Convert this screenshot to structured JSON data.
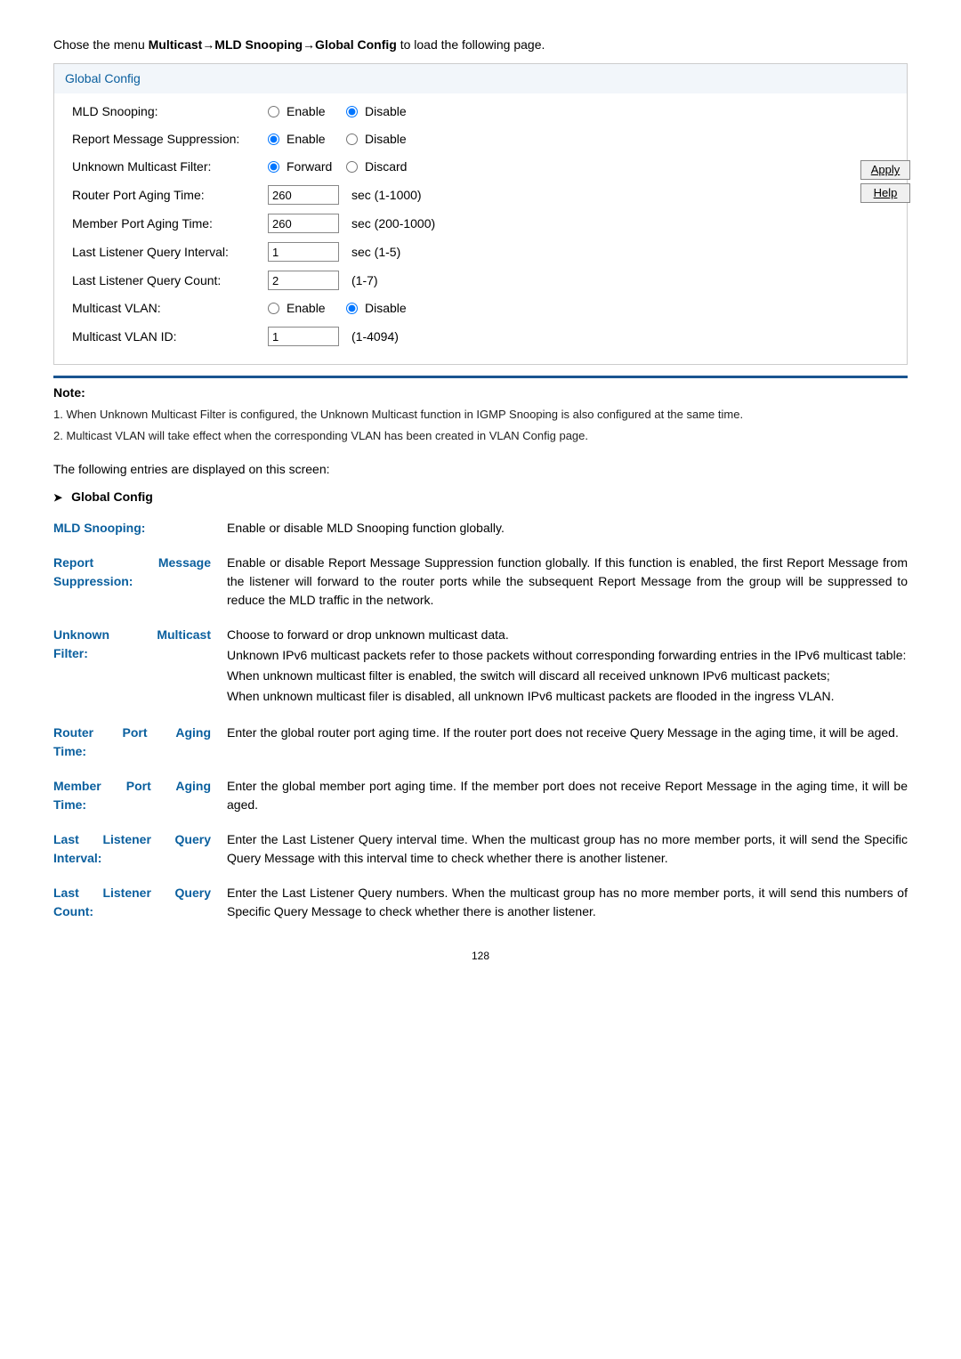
{
  "intro_prefix": "Chose the menu ",
  "intro_path": "Multicast→MLD Snooping→Global Config",
  "intro_suffix": " to load the following page.",
  "panel": {
    "title": "Global Config",
    "rows": {
      "mld_snooping": {
        "label": "MLD Snooping:",
        "opt1": "Enable",
        "opt2": "Disable"
      },
      "report_suppression": {
        "label": "Report Message Suppression:",
        "opt1": "Enable",
        "opt2": "Disable"
      },
      "unknown_filter": {
        "label": "Unknown Multicast Filter:",
        "opt1": "Forward",
        "opt2": "Discard"
      },
      "router_aging": {
        "label": "Router Port Aging Time:",
        "value": "260",
        "unit": "sec (1-1000)"
      },
      "member_aging": {
        "label": "Member Port Aging Time:",
        "value": "260",
        "unit": "sec (200-1000)"
      },
      "last_interval": {
        "label": "Last Listener Query Interval:",
        "value": "1",
        "unit": "sec (1-5)"
      },
      "last_count": {
        "label": "Last Listener Query Count:",
        "value": "2",
        "unit": "(1-7)"
      },
      "multicast_vlan": {
        "label": "Multicast VLAN:",
        "opt1": "Enable",
        "opt2": "Disable"
      },
      "multicast_vlan_id": {
        "label": "Multicast VLAN ID:",
        "value": "1",
        "unit": "(1-4094)"
      }
    },
    "apply": "Apply",
    "help": "Help"
  },
  "note": {
    "title": "Note:",
    "line1": "1. When Unknown Multicast Filter is configured, the Unknown Multicast function in IGMP Snooping is also configured at the same time.",
    "line2": "2. Multicast VLAN will take effect when the corresponding VLAN has been created in VLAN Config page."
  },
  "follow": "The following entries are displayed on this screen:",
  "section_title": "Global Config",
  "descriptions": {
    "mld": {
      "label": "MLD Snooping:",
      "text": "Enable or disable MLD Snooping function globally."
    },
    "report": {
      "label": "Report Message Suppression:",
      "text": "Enable or disable Report Message Suppression function globally. If this function is enabled, the first Report Message from the listener will forward to the router ports while the subsequent Report Message from the group will be suppressed to reduce the MLD traffic in the network."
    },
    "unknown": {
      "label": "Unknown Multicast Filter:",
      "p1": "Choose to forward or drop unknown multicast data.",
      "p2": "Unknown IPv6 multicast packets refer to those packets without corresponding forwarding entries in the IPv6 multicast table:",
      "p3": "When unknown multicast filter is enabled, the switch will discard all received unknown IPv6 multicast packets;",
      "p4": "When unknown multicast filer is disabled, all unknown IPv6 multicast packets are flooded in the ingress VLAN."
    },
    "router_aging": {
      "label": "Router Port Aging Time:",
      "text": "Enter the global router port aging time. If the router port does not receive Query Message in the aging time, it will be aged."
    },
    "member_aging": {
      "label": "Member Port Aging Time:",
      "text": "Enter the global member port aging time. If the member port does not receive Report Message in the aging time, it will be aged."
    },
    "last_interval": {
      "label": "Last Listener Query Interval:",
      "text": "Enter the Last Listener Query interval time. When the multicast group has no more member ports, it will send the Specific Query Message with this interval time to check whether there is another listener."
    },
    "last_count": {
      "label": "Last Listener Query Count:",
      "text": "Enter the Last Listener Query numbers. When the multicast group has no more member ports, it will send this numbers of Specific Query Message to check whether there is another listener."
    }
  },
  "page_num": "128"
}
